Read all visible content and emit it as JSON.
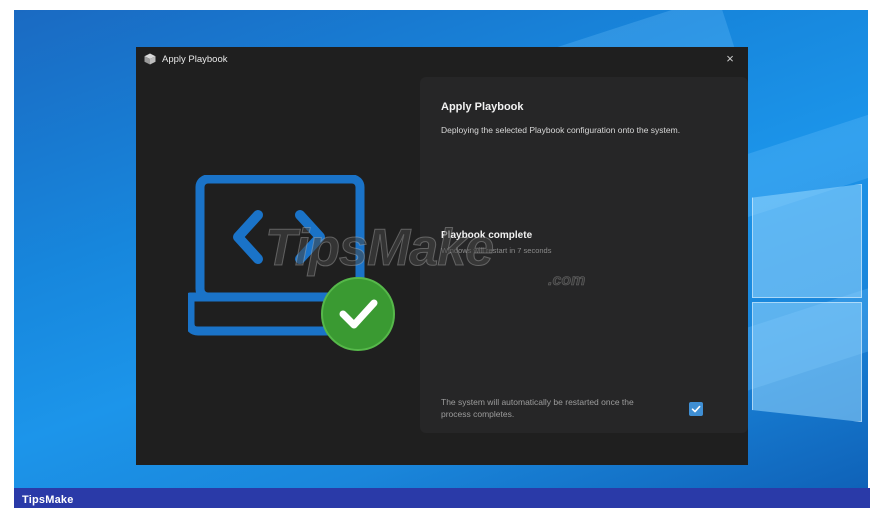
{
  "window": {
    "title": "Apply Playbook",
    "close_glyph": "×"
  },
  "panel": {
    "heading": "Apply Playbook",
    "description": "Deploying the selected Playbook configuration onto the system.",
    "status_title": "Playbook complete",
    "status_subtitle": "Windows will restart in 7 seconds",
    "restart_note": "The system will automatically be restarted once the process completes.",
    "restart_checkbox_checked": true
  },
  "watermark": {
    "text": "TipsMake",
    "suffix": ".com"
  },
  "footer": {
    "brand": "TipsMake"
  },
  "icons": {
    "app": "app-cube-icon",
    "close": "close-icon",
    "illustration": "laptop-code-icon",
    "success": "checkmark-circle-icon",
    "checkbox": "checkbox-checked-icon"
  },
  "colors": {
    "accent_blue": "#1a73c8",
    "success_green": "#3a9a32",
    "dialog_bg": "#1f1f1f",
    "panel_bg": "#262627",
    "taskbar": "#2a3aa8"
  }
}
